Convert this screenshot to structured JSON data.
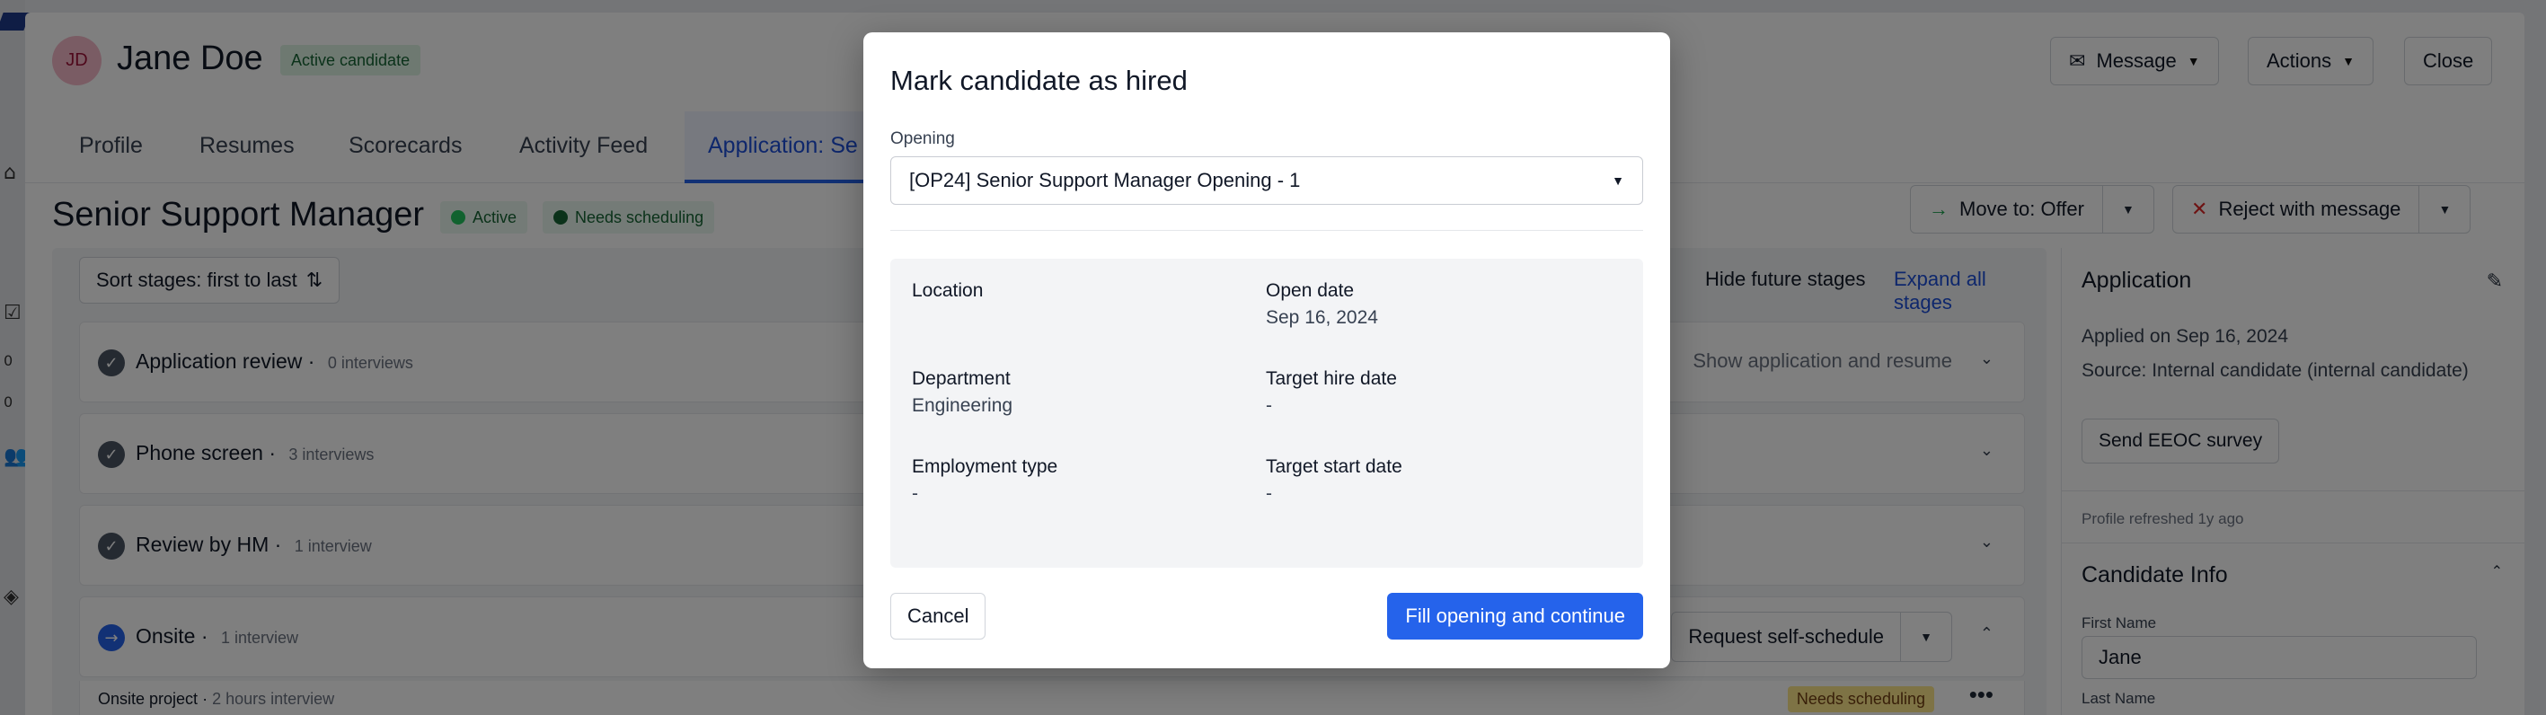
{
  "candidate": {
    "initials": "JD",
    "name": "Jane Doe",
    "status_badge": "Active candidate"
  },
  "header_actions": {
    "message": "Message",
    "actions": "Actions",
    "close": "Close"
  },
  "tabs": [
    {
      "label": "Profile"
    },
    {
      "label": "Resumes"
    },
    {
      "label": "Scorecards"
    },
    {
      "label": "Activity Feed"
    },
    {
      "label": "Application: Se"
    }
  ],
  "application": {
    "title": "Senior Support Manager",
    "pills": [
      {
        "label": "Active",
        "color": "#22c55e",
        "bg": "#dcfce7"
      },
      {
        "label": "Needs scheduling",
        "color": "#166534",
        "bg": "#dcfce7"
      }
    ],
    "move_to": "Move to: Offer",
    "reject": "Reject with message"
  },
  "stages": {
    "sort_label": "Sort stages: first to last",
    "hide_future": "Hide future stages",
    "expand_all": "Expand all stages",
    "items": [
      {
        "name": "Application review",
        "count": "0 interviews",
        "aux": "Show application and resume"
      },
      {
        "name": "Phone screen",
        "count": "3 interviews"
      },
      {
        "name": "Review by HM",
        "count": "1 interview"
      },
      {
        "name": "Onsite",
        "count": "1 interview",
        "aux": "Request self-schedule"
      }
    ],
    "sub_item": {
      "name": "Onsite project",
      "detail": "2 hours interview",
      "badge": "Needs scheduling"
    }
  },
  "right_panel": {
    "title": "Application",
    "applied": "Applied on Sep 16, 2024",
    "source": "Source: Internal candidate (internal candidate)",
    "eeoc_button": "Send EEOC survey",
    "refreshed": "Profile refreshed 1y ago",
    "info_title": "Candidate Info",
    "first_name_label": "First Name",
    "first_name_value": "Jane",
    "last_name_label": "Last Name"
  },
  "modal": {
    "title": "Mark candidate as hired",
    "opening_label": "Opening",
    "opening_value": "[OP24] Senior Support Manager Opening - 1",
    "fields": {
      "location": {
        "label": "Location",
        "value": ""
      },
      "open_date": {
        "label": "Open date",
        "value": "Sep 16, 2024"
      },
      "department": {
        "label": "Department",
        "value": "Engineering"
      },
      "target_hire": {
        "label": "Target hire date",
        "value": "-"
      },
      "employment_type": {
        "label": "Employment type",
        "value": "-"
      },
      "target_start": {
        "label": "Target start date",
        "value": "-"
      }
    },
    "cancel": "Cancel",
    "primary": "Fill opening and continue"
  },
  "rail": {
    "num1": "0",
    "num2": "0"
  },
  "colors": {
    "primary": "#2563eb",
    "overlay": "rgba(0,0,0,0.5)"
  }
}
